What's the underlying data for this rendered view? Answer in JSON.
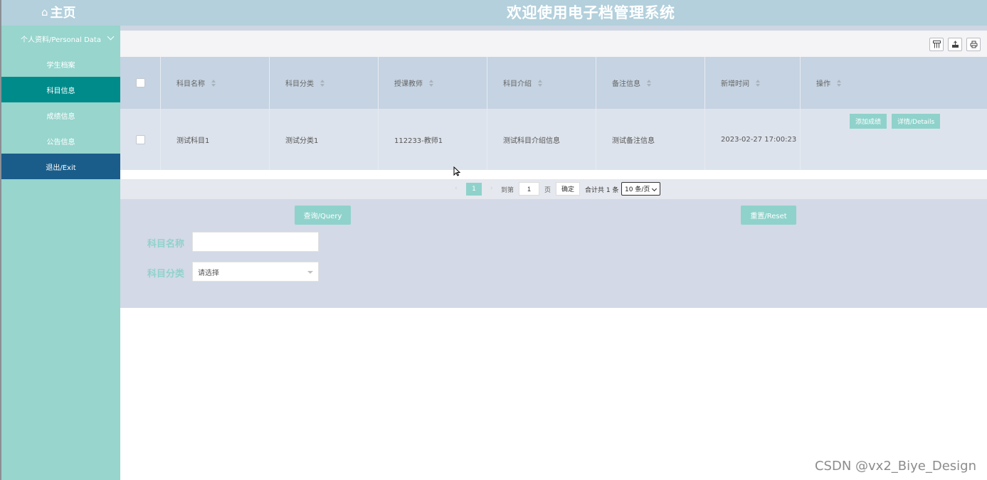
{
  "header": {
    "home_icon": "home-icon",
    "home_label": "主页",
    "title": "欢迎使用电子档管理系统"
  },
  "sidebar": {
    "group_label": "个人资料/Personal Data",
    "items": [
      {
        "label": "学生档案",
        "active": false
      },
      {
        "label": "科目信息",
        "active": true
      },
      {
        "label": "成绩信息",
        "active": false
      },
      {
        "label": "公告信息",
        "active": false
      },
      {
        "label": "退出/Exit",
        "active": false
      }
    ]
  },
  "toolbar": {
    "icons": [
      "columns-icon",
      "export-icon",
      "print-icon"
    ]
  },
  "table": {
    "headers": [
      "科目名称",
      "科目分类",
      "授课教师",
      "科目介绍",
      "备注信息",
      "新增时间",
      "操作"
    ],
    "rows": [
      {
        "name": "测试科目1",
        "category": "测试分类1",
        "teacher": "112233-教师1",
        "intro": "测试科目介绍信息",
        "remark": "测试备注信息",
        "time": "2023-02-27 17:00:23",
        "actions": [
          "添加成绩",
          "详情/Details"
        ]
      }
    ]
  },
  "pagination": {
    "prev": "‹",
    "current_page": "1",
    "next": "›",
    "goto_label": "到第",
    "page_input": "1",
    "page_unit": "页",
    "confirm": "确定",
    "total": "合计共 1 条",
    "page_size": "10 条/页"
  },
  "search": {
    "query_button": "查询/Query",
    "reset_button": "重置/Reset",
    "name_label": "科目名称",
    "name_value": "",
    "category_label": "科目分类",
    "category_placeholder": "请选择"
  },
  "watermark": "CSDN @vx2_Biye_Design",
  "colors": {
    "header_bg": "#b3d0dc",
    "sidebar_bg": "#97d5cd",
    "active_item": "#008b8b",
    "exit_item": "#1a5d8a",
    "accent": "#8fd2cb"
  }
}
